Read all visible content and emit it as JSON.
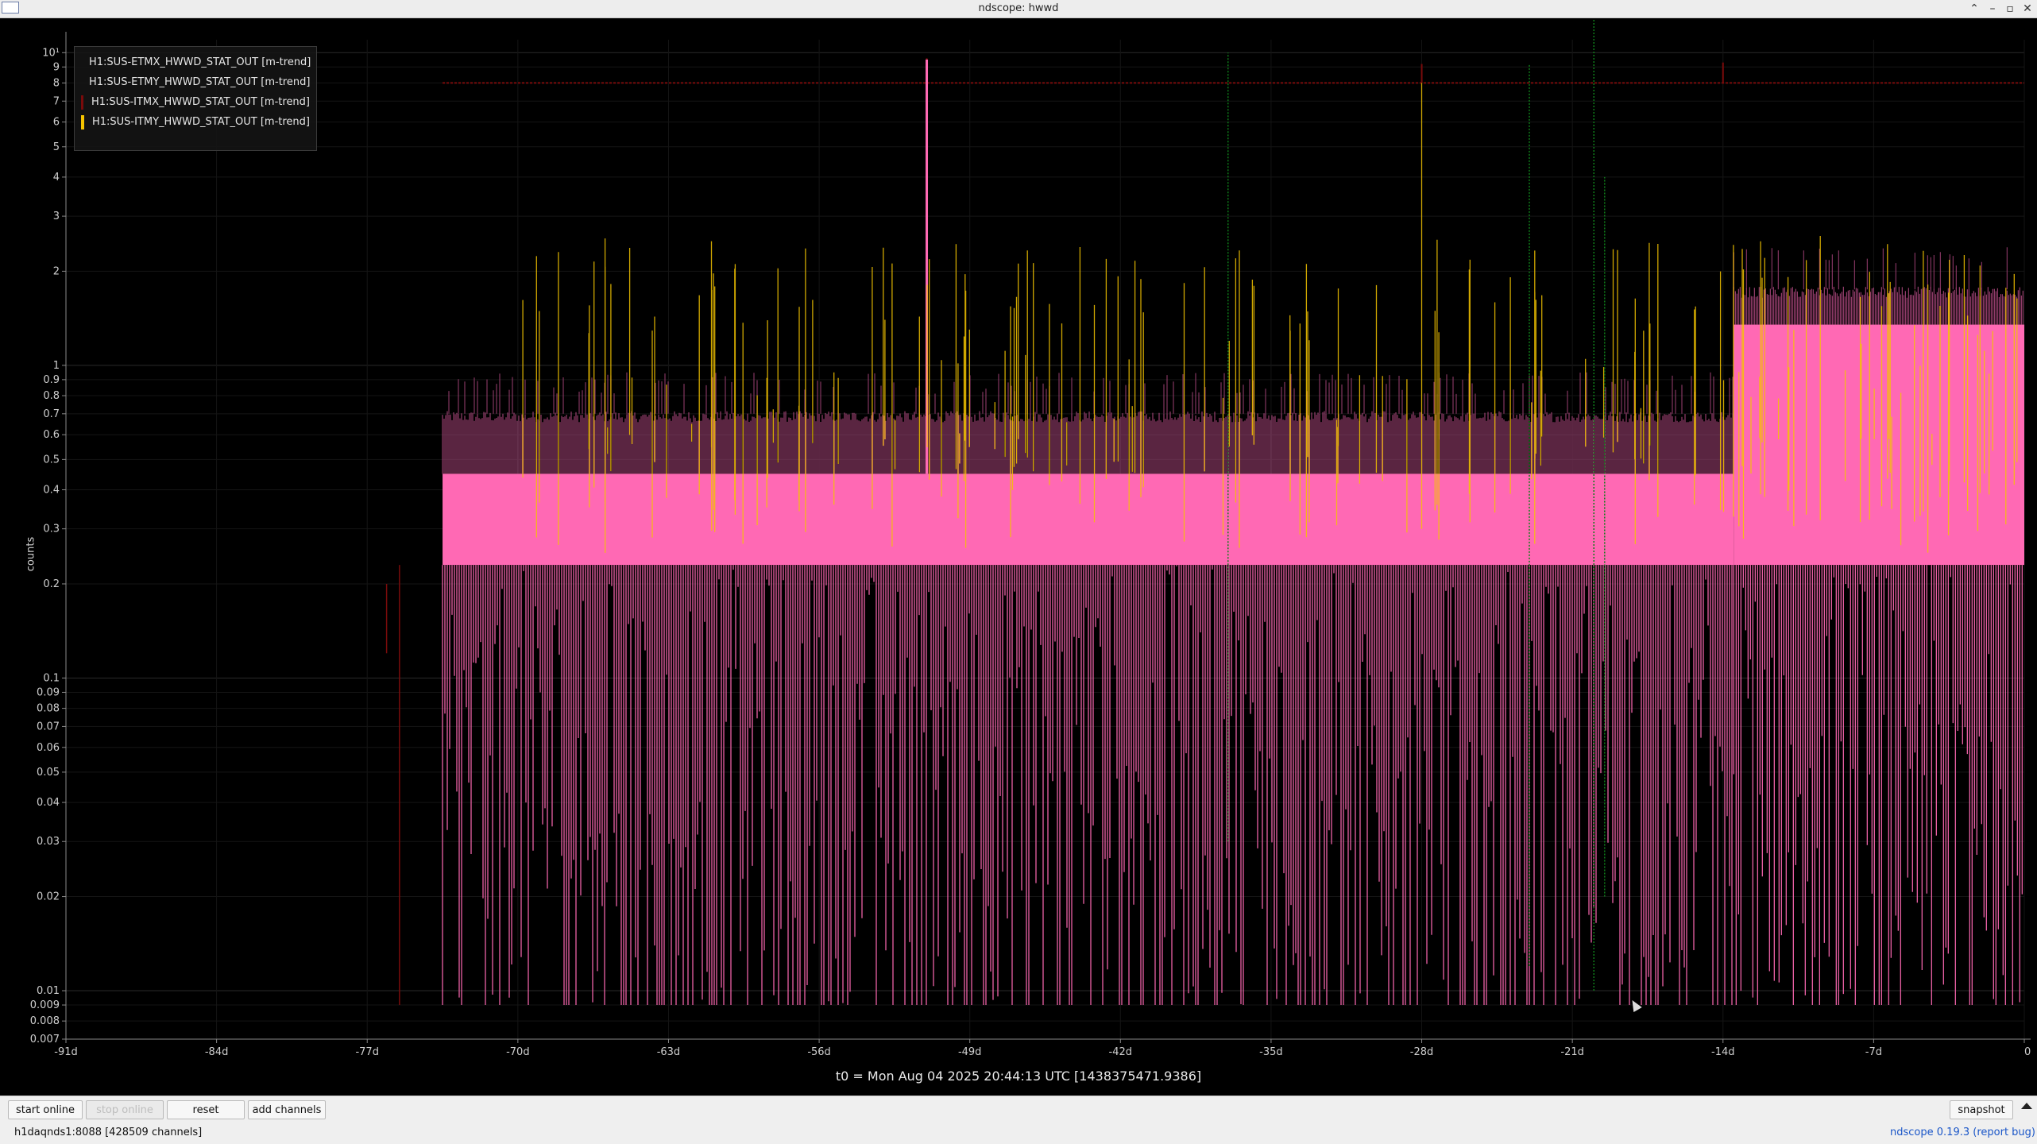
{
  "window": {
    "title": "ndscope: hwwd",
    "controls": [
      "minimize-icon",
      "maximize-icon",
      "close-icon"
    ]
  },
  "plot": {
    "ylabel": "counts",
    "t0_label": "t0 = Mon Aug 04 2025 20:44:13 UTC [1438375471.9386]",
    "legend": [
      {
        "label": "H1:SUS-ETMX_HWWD_STAT_OUT [m-trend]",
        "color": "#0f7d1a"
      },
      {
        "label": "H1:SUS-ETMY_HWWD_STAT_OUT [m-trend]",
        "color": "#ff69b4"
      },
      {
        "label": "H1:SUS-ITMX_HWWD_STAT_OUT [m-trend]",
        "color": "#7a0b0b"
      },
      {
        "label": "H1:SUS-ITMY_HWWD_STAT_OUT [m-trend]",
        "color": "#f5c400"
      }
    ]
  },
  "chart_data": {
    "type": "line",
    "title": "",
    "xlabel": "",
    "ylabel": "counts",
    "yscale": "log",
    "ylim": [
      0.007,
      11
    ],
    "xlim": [
      -91,
      0
    ],
    "x_ticks": [
      "-91d",
      "-84d",
      "-77d",
      "-70d",
      "-63d",
      "-56d",
      "-49d",
      "-42d",
      "-35d",
      "-28d",
      "-21d",
      "-14d",
      "-7d",
      "0"
    ],
    "y_ticks": [
      {
        "v": 10,
        "label": "10¹"
      },
      {
        "v": 9,
        "label": "9"
      },
      {
        "v": 8,
        "label": "8"
      },
      {
        "v": 7,
        "label": "7"
      },
      {
        "v": 6,
        "label": "6"
      },
      {
        "v": 5,
        "label": "5"
      },
      {
        "v": 4,
        "label": "4"
      },
      {
        "v": 3,
        "label": "3"
      },
      {
        "v": 2,
        "label": "2"
      },
      {
        "v": 1,
        "label": "1"
      },
      {
        "v": 0.9,
        "label": "0.9"
      },
      {
        "v": 0.8,
        "label": "0.8"
      },
      {
        "v": 0.7,
        "label": "0.7"
      },
      {
        "v": 0.6,
        "label": "0.6"
      },
      {
        "v": 0.5,
        "label": "0.5"
      },
      {
        "v": 0.4,
        "label": "0.4"
      },
      {
        "v": 0.3,
        "label": "0.3"
      },
      {
        "v": 0.2,
        "label": "0.2"
      },
      {
        "v": 0.1,
        "label": "0.1"
      },
      {
        "v": 0.09,
        "label": "0.09"
      },
      {
        "v": 0.08,
        "label": "0.08"
      },
      {
        "v": 0.07,
        "label": "0.07"
      },
      {
        "v": 0.06,
        "label": "0.06"
      },
      {
        "v": 0.05,
        "label": "0.05"
      },
      {
        "v": 0.04,
        "label": "0.04"
      },
      {
        "v": 0.03,
        "label": "0.03"
      },
      {
        "v": 0.02,
        "label": "0.02"
      },
      {
        "v": 0.01,
        "label": "0.01"
      },
      {
        "v": 0.009,
        "label": "0.009"
      },
      {
        "v": 0.008,
        "label": "0.008"
      },
      {
        "v": 0.007,
        "label": "0.007"
      }
    ],
    "grid": true,
    "legend_position": "top-left",
    "series": [
      {
        "name": "H1:SUS-ETMX_HWWD_STAT_OUT [m-trend]",
        "color": "#0f7d1a",
        "approx": "near zero except sparse spikes ~ -37d, -23d, -20d (up to ~14 counts)"
      },
      {
        "name": "H1:SUS-ETMY_HWWD_STAT_OUT [m-trend]",
        "color": "#ff69b4",
        "segments": [
          {
            "x": [
              -73.5,
              -13.5
            ],
            "band": [
              0.23,
              0.45
            ],
            "max_typical": 0.7,
            "max_peak": 0.95,
            "min": 0.009
          },
          {
            "x": [
              -13.5,
              0
            ],
            "band": [
              0.23,
              1.35
            ],
            "max_typical": 1.75,
            "max_peak": 2.4,
            "min": 0.009
          }
        ],
        "spikes": [
          {
            "x": -51,
            "y": 9.5
          }
        ]
      },
      {
        "name": "H1:SUS-ITMX_HWWD_STAT_OUT [m-trend]",
        "color": "#7a0b0b",
        "flat_line": {
          "x": [
            -73.5,
            0
          ],
          "y": 8
        },
        "spikes": [
          {
            "x": -51,
            "y": 9.6
          },
          {
            "x": -28,
            "y": 9.2
          },
          {
            "x": -14,
            "y": 9.3
          }
        ]
      },
      {
        "name": "H1:SUS-ITMY_HWWD_STAT_OUT [m-trend]",
        "color": "#f5c400",
        "approx": "sparse spikes between 0.3 and 2.6 counts, one to ~8 at -28d"
      }
    ]
  },
  "toolbar": {
    "start_online": "start online",
    "stop_online": "stop online",
    "reset": "reset",
    "add_channels": "add channels",
    "snapshot": "snapshot"
  },
  "status": {
    "server": "h1daqnds1:8088  [428509 channels]",
    "app_link": "ndscope 0.19.3",
    "bug_link": "(report bug)"
  }
}
